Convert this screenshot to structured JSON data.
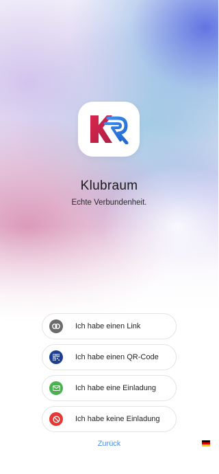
{
  "app": {
    "name": "Klubraum",
    "tagline": "Echte Verbundenheit.",
    "logo_icon": "klubraum-logo-icon"
  },
  "options": [
    {
      "label": "Ich habe einen Link",
      "icon": "link-icon",
      "color": "#6b6b6b"
    },
    {
      "label": "Ich habe einen QR-Code",
      "icon": "qr-code-icon",
      "color": "#1e3f8f"
    },
    {
      "label": "Ich habe eine Einladung",
      "icon": "mail-icon",
      "color": "#4caf50"
    },
    {
      "label": "Ich habe keine Einladung",
      "icon": "no-entry-icon",
      "color": "#e53935"
    }
  ],
  "back_label": "Zurück",
  "language": {
    "icon": "german-flag-icon",
    "colors": [
      "#000000",
      "#dd0000",
      "#ffce00"
    ]
  },
  "colors": {
    "link_blue": "#4a8ee0",
    "logo_red": "#c8234a",
    "logo_blue": "#2f7fe0"
  }
}
